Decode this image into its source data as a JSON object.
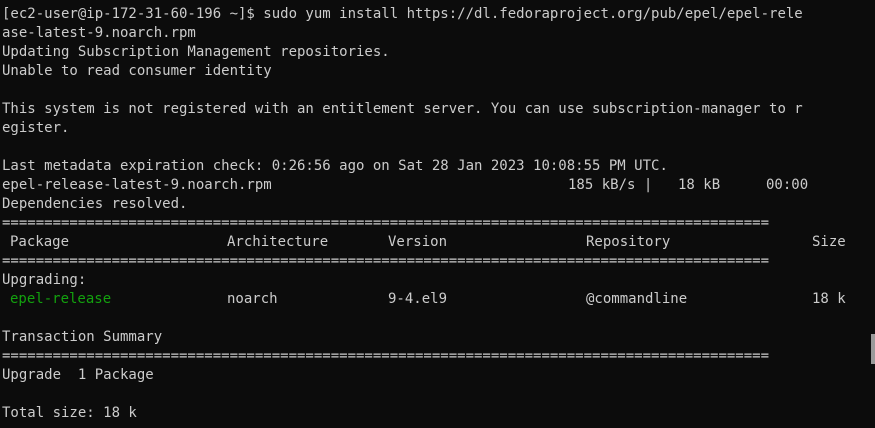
{
  "lines": {
    "prompt_cmd": "[ec2-user@ip-172-31-60-196 ~]$ sudo yum install https://dl.fedoraproject.org/pub/epel/epel-rele",
    "prompt_cmd_wrap": "ase-latest-9.noarch.rpm",
    "updating": "Updating Subscription Management repositories.",
    "unable": "Unable to read consumer identity",
    "not_registered": "This system is not registered with an entitlement server. You can use subscription-manager to r",
    "not_registered_wrap": "egister.",
    "metadata": "Last metadata expiration check: 0:26:56 ago on Sat 28 Jan 2023 10:08:55 PM UTC.",
    "download_file": "epel-release-latest-9.noarch.rpm",
    "download_speed": "185 kB/s |",
    "download_size": "18 kB",
    "download_time": "00:00",
    "deps_resolved": "Dependencies resolved.",
    "separator": "===========================================================================================",
    "upgrading": "Upgrading:",
    "transaction_summary": "Transaction Summary",
    "upgrade_count": "Upgrade  1 Package",
    "total_size": "Total size: 18 k"
  },
  "table": {
    "headers": {
      "package": "Package",
      "architecture": "Architecture",
      "version": "Version",
      "repository": "Repository",
      "size": "Size"
    },
    "rows": [
      {
        "package": "epel-release",
        "architecture": "noarch",
        "version": "9-4.el9",
        "repository": "@commandline",
        "size": "18 k"
      }
    ]
  },
  "colors": {
    "background": "#0c0c0c",
    "text": "#cccccc",
    "package_highlight": "#13a10e"
  }
}
